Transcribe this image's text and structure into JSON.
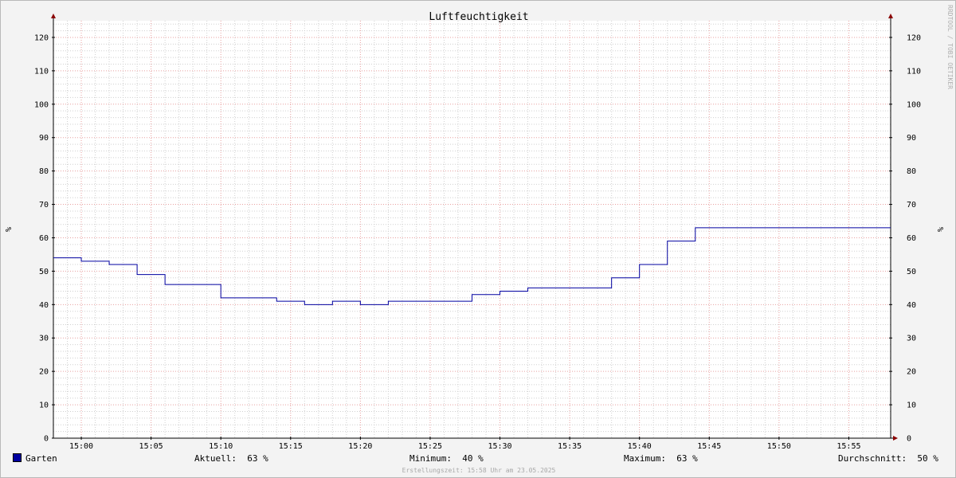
{
  "chart_data": {
    "type": "line",
    "title": "Luftfeuchtigkeit",
    "ylabel": "%",
    "ylim": [
      0,
      125
    ],
    "yticks": [
      0,
      10,
      20,
      30,
      40,
      50,
      60,
      70,
      80,
      90,
      100,
      110,
      120
    ],
    "xlim": [
      "14:58",
      "15:58"
    ],
    "xticks": [
      "15:00",
      "15:05",
      "15:10",
      "15:15",
      "15:20",
      "15:25",
      "15:30",
      "15:35",
      "15:40",
      "15:45",
      "15:50",
      "15:55"
    ],
    "grid": true,
    "step": true,
    "series": [
      {
        "name": "Garten",
        "color": "#0000a0",
        "x": [
          "14:58",
          "15:00",
          "15:02",
          "15:04",
          "15:06",
          "15:10",
          "15:14",
          "15:16",
          "15:18",
          "15:20",
          "15:22",
          "15:28",
          "15:30",
          "15:32",
          "15:38",
          "15:40",
          "15:42",
          "15:44",
          "15:46"
        ],
        "y": [
          54,
          53,
          52,
          49,
          46,
          42,
          41,
          40,
          41,
          40,
          41,
          43,
          44,
          45,
          48,
          52,
          59,
          63,
          63
        ]
      }
    ]
  },
  "legend": {
    "series_name": "Garten",
    "current_label": "Aktuell:",
    "current_value": "63 %",
    "min_label": "Minimum:",
    "min_value": "40 %",
    "max_label": "Maximum:",
    "max_value": "63 %",
    "avg_label": "Durchschnitt:",
    "avg_value": "50 %"
  },
  "footer": "Erstellungszeit: 15:58 Uhr am 23.05.2025",
  "watermark": "RRDTOOL / TOBI OETIKER",
  "colors": {
    "line": "#0000a0",
    "major_grid": "#e8a0a0",
    "minor_grid": "#d0d0d0",
    "axis": "#000000",
    "arrow": "#8b0000"
  }
}
